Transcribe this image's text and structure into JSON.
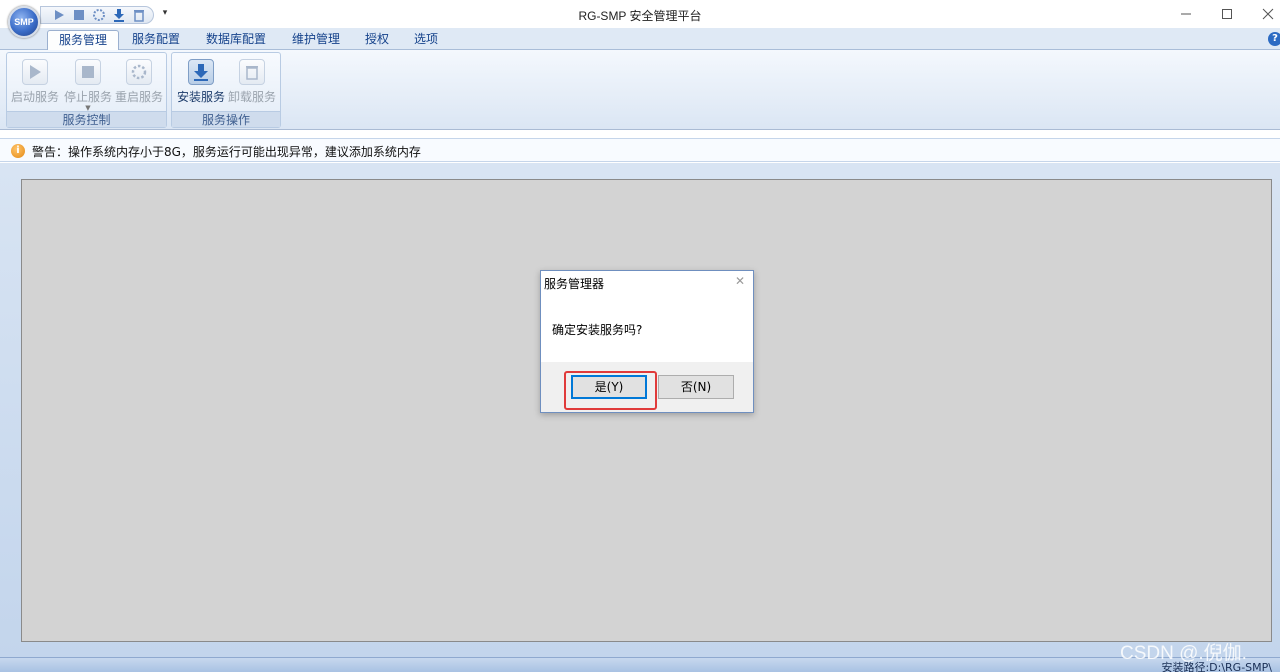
{
  "window": {
    "title": "RG-SMP 安全管理平台",
    "logo_text": "SMP",
    "qat_dropdown": "▾"
  },
  "tabs": [
    {
      "label": "服务管理",
      "active": true
    },
    {
      "label": "服务配置"
    },
    {
      "label": "数据库配置"
    },
    {
      "label": "维护管理"
    },
    {
      "label": "授权"
    },
    {
      "label": "选项"
    }
  ],
  "ribbon": {
    "groups": [
      {
        "label": "服务控制",
        "buttons": [
          {
            "label": "启动服务",
            "icon": "play-icon"
          },
          {
            "label": "停止服务",
            "icon": "stop-icon"
          },
          {
            "label": "重启服务",
            "icon": "restart-icon"
          }
        ]
      },
      {
        "label": "服务操作",
        "buttons": [
          {
            "label": "安装服务",
            "icon": "install-icon"
          },
          {
            "label": "卸载服务",
            "icon": "uninstall-icon"
          }
        ]
      }
    ]
  },
  "warning": {
    "text": "警告：操作系统内存小于8G，服务运行可能出现异常，建议添加系统内存",
    "icon_glyph": "i"
  },
  "dialog": {
    "title": "服务管理器",
    "message": "确定安装服务吗?",
    "yes_label": "是(Y)",
    "no_label": "否(N)",
    "close_glyph": "✕"
  },
  "statusbar": {
    "install_path": "安装路径:D:\\RG-SMP\\"
  },
  "watermark": "CSDN @.倪伽.",
  "colors": {
    "accent": "#15428b",
    "highlight": "#e03b3b",
    "focus": "#0078d7"
  }
}
